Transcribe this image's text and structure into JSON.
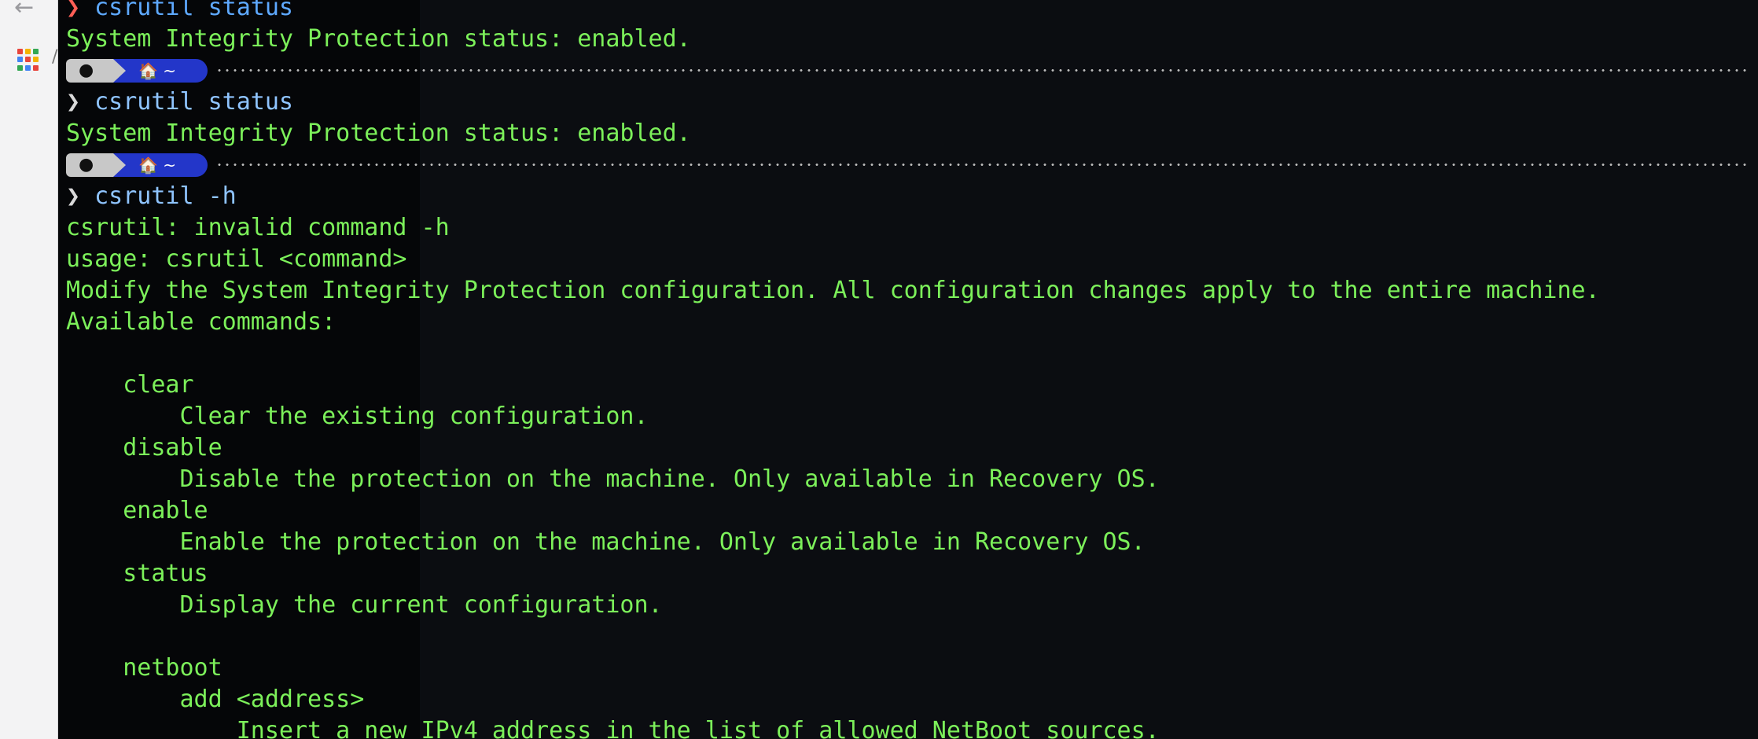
{
  "browser": {
    "back_icon": "arrow-left-icon",
    "apps_icon": "apps-grid-icon",
    "apps_colors": [
      "#e8453c",
      "#f4b400",
      "#34a853",
      "#4285f4",
      "#e8453c",
      "#f4b400",
      "#34a853",
      "#4285f4",
      "#e8453c"
    ],
    "tab_fragment": "/"
  },
  "prompt": {
    "home_segment": "🏠 ~",
    "arrow": "❯",
    "segment_colors": {
      "apple": "#c8c8c8",
      "home": "#2336c9"
    }
  },
  "terminal": {
    "colors": {
      "output": "#7CF05A",
      "command": "#5ea9ff",
      "prompt_arrow": "#ff5f56"
    },
    "block1": {
      "command": "csrutil status",
      "output": "System Integrity Protection status: enabled."
    },
    "block2": {
      "command": "csrutil status",
      "output": "System Integrity Protection status: enabled."
    },
    "block3": {
      "command": "csrutil -h",
      "output_lines": [
        "csrutil: invalid command -h",
        "usage: csrutil <command>",
        "Modify the System Integrity Protection configuration. All configuration changes apply to the entire machine.",
        "Available commands:",
        "",
        "    clear",
        "        Clear the existing configuration.",
        "    disable",
        "        Disable the protection on the machine. Only available in Recovery OS.",
        "    enable",
        "        Enable the protection on the machine. Only available in Recovery OS.",
        "    status",
        "        Display the current configuration.",
        "",
        "    netboot",
        "        add <address>",
        "            Insert a new IPv4 address in the list of allowed NetBoot sources."
      ]
    }
  }
}
